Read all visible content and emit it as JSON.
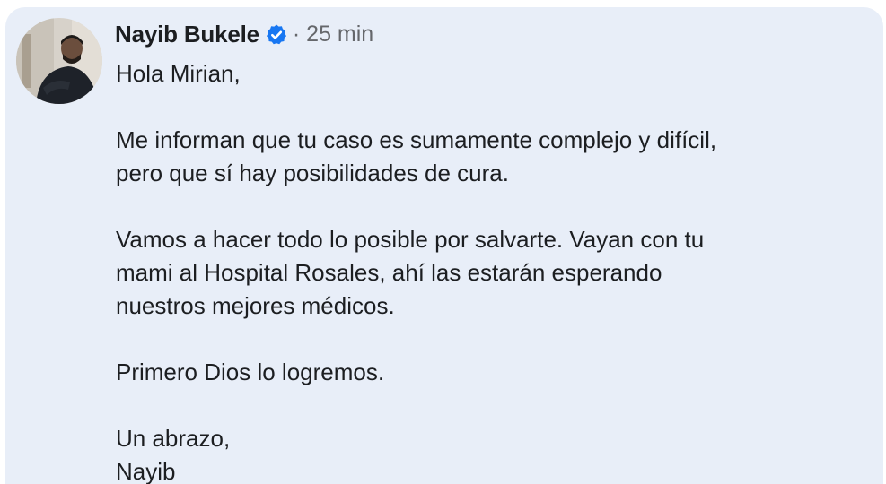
{
  "post": {
    "author": "Nayib Bukele",
    "verified_icon": "verified-badge-icon",
    "separator": "·",
    "timestamp": "25 min",
    "accent_color": "#1877f2",
    "paragraphs": [
      [
        "Hola Mirian,"
      ],
      [
        "Me informan que tu caso es sumamente complejo y difícil,",
        "pero que sí hay posibilidades de cura."
      ],
      [
        "Vamos a hacer todo lo posible por salvarte. Vayan con tu",
        "mami al Hospital Rosales, ahí las estarán esperando",
        "nuestros mejores médicos."
      ],
      [
        "Primero Dios lo logremos."
      ],
      [
        "Un abrazo,",
        "Nayib"
      ]
    ]
  }
}
